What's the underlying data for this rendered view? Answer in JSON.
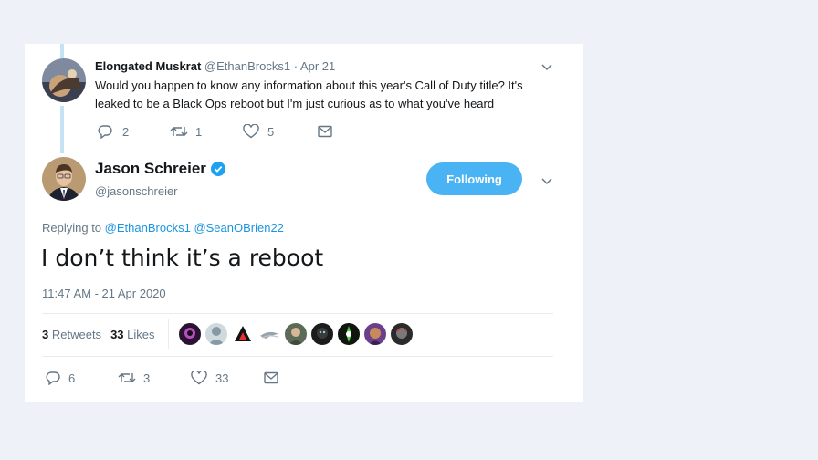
{
  "reply_tweet": {
    "author_name": "Elongated Muskrat",
    "author_handle": "@EthanBrocks1",
    "separator": "·",
    "date": "Apr 21",
    "text": "Would you happen to know any information about this year's Call of Duty title? It's leaked to be a Black Ops reboot but I'm just curious as to what you've heard",
    "replies": "2",
    "retweets": "1",
    "likes": "5"
  },
  "main_tweet": {
    "author_name": "Jason Schreier",
    "author_handle": "@jasonschreier",
    "follow_label": "Following",
    "replying_prefix": "Replying to",
    "mention_1": "@EthanBrocks1",
    "mention_2": "@SeanOBrien22",
    "text": "I don’t think it’s a reboot",
    "timestamp": "11:47 AM - 21 Apr 2020",
    "retweet_count": "3",
    "retweet_label": "Retweets",
    "like_count": "33",
    "like_label": "Likes",
    "replies": "6",
    "retweets": "3",
    "likes": "33"
  },
  "colors": {
    "accent": "#1b95e0",
    "button": "#4ab3f4",
    "muted": "#657786",
    "verified": "#1da1f2",
    "thread_line": "#c5e3f5"
  },
  "icons": [
    "chevron-down-icon",
    "reply-icon",
    "retweet-icon",
    "like-icon",
    "message-icon",
    "verified-badge-icon"
  ]
}
